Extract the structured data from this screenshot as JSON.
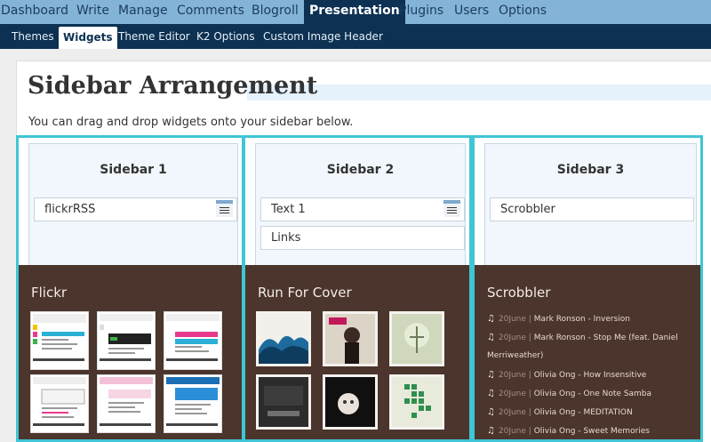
{
  "topnav": {
    "items": [
      {
        "label": "Dashboard"
      },
      {
        "label": "Write"
      },
      {
        "label": "Manage"
      },
      {
        "label": "Comments"
      },
      {
        "label": "Blogroll"
      },
      {
        "label": "Presentation"
      },
      {
        "label": "Plugins"
      },
      {
        "label": "Users"
      },
      {
        "label": "Options"
      }
    ],
    "active": "Presentation"
  },
  "subnav": {
    "items": [
      {
        "label": "Themes"
      },
      {
        "label": "Widgets"
      },
      {
        "label": "Theme Editor"
      },
      {
        "label": "K2 Options"
      },
      {
        "label": "Custom Image Header"
      }
    ],
    "active": "Widgets"
  },
  "page": {
    "title": "Sidebar Arrangement",
    "intro": "You can drag and drop widgets onto your sidebar below."
  },
  "sidebars": [
    {
      "title": "Sidebar 1",
      "widgets": [
        "flickrRSS"
      ],
      "preview": {
        "title": "Flickr",
        "icon": "flickr-screenshot-thumbnails"
      }
    },
    {
      "title": "Sidebar 2",
      "widgets": [
        "Text 1",
        "Links"
      ],
      "preview": {
        "title": "Run For Cover",
        "icon": "album-cover-art"
      }
    },
    {
      "title": "Sidebar 3",
      "widgets": [
        "Scrobbler"
      ],
      "preview": {
        "title": "Scrobbler",
        "tracks": [
          {
            "date": "20June |",
            "text": "Mark Ronson - Inversion"
          },
          {
            "date": "20June |",
            "text": "Mark Ronson - Stop Me (feat. Daniel"
          },
          {
            "date": "",
            "text": "Merriweather)"
          },
          {
            "date": "20June |",
            "text": "Olivia Ong - How Insensitive"
          },
          {
            "date": "20June |",
            "text": "Olivia Ong - One Note Samba"
          },
          {
            "date": "20June |",
            "text": "Olivia Ong - MEDITATION"
          },
          {
            "date": "20June |",
            "text": "Olivia Ong - Sweet Memories"
          }
        ]
      }
    }
  ],
  "colors": {
    "nav_bg": "#83b4d8",
    "subnav_bg": "#0d3152",
    "column_border": "#3fc5d6",
    "preview_bg": "#4b352c"
  }
}
